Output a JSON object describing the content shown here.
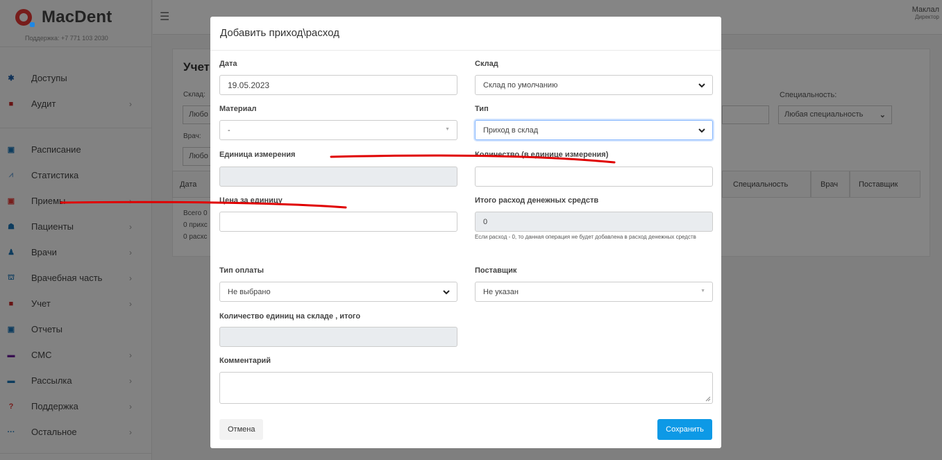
{
  "app": {
    "logo_text": "MacDent",
    "support": "Поддержка: +7 771 103 2030"
  },
  "user": {
    "name": "Маклал",
    "role": "Директор"
  },
  "sidebar": {
    "items": [
      {
        "label": "Доступы",
        "icon": "gear-icon",
        "color": "#1e5fa8",
        "glyph": "✱",
        "chevron": false
      },
      {
        "label": "Аудит",
        "icon": "briefcase-icon",
        "color": "#c62828",
        "glyph": "■",
        "chevron": true
      },
      {
        "label": "Расписание",
        "icon": "calendar-icon",
        "color": "#1a73b5",
        "glyph": "▣",
        "chevron": false
      },
      {
        "label": "Статистика",
        "icon": "chart-icon",
        "color": "#7aa7d6",
        "glyph": "⩘",
        "chevron": false
      },
      {
        "label": "Приемы",
        "icon": "calendar-check-icon",
        "color": "#e53935",
        "glyph": "▣",
        "chevron": true
      },
      {
        "label": "Пациенты",
        "icon": "users-icon",
        "color": "#1a73b5",
        "glyph": "☗",
        "chevron": true
      },
      {
        "label": "Врачи",
        "icon": "doctor-icon",
        "color": "#1a73b5",
        "glyph": "♟",
        "chevron": true
      },
      {
        "label": "Врачебная часть",
        "icon": "hospital-icon",
        "color": "#1a73b5",
        "glyph": "⛫",
        "chevron": true
      },
      {
        "label": "Учет",
        "icon": "briefcase-icon",
        "color": "#c62828",
        "glyph": "■",
        "chevron": true
      },
      {
        "label": "Отчеты",
        "icon": "calendar-icon",
        "color": "#1a73b5",
        "glyph": "▣",
        "chevron": false
      },
      {
        "label": "СМС",
        "icon": "sms-icon",
        "color": "#6a1b9a",
        "glyph": "▬",
        "chevron": true
      },
      {
        "label": "Рассылка",
        "icon": "message-icon",
        "color": "#1a73b5",
        "glyph": "▬",
        "chevron": true
      },
      {
        "label": "Поддержка",
        "icon": "question-icon",
        "color": "#e53935",
        "glyph": "?",
        "chevron": true
      },
      {
        "label": "Остальное",
        "icon": "dots-icon",
        "color": "#1a73b5",
        "glyph": "···",
        "chevron": true
      }
    ]
  },
  "background": {
    "title": "Учет",
    "sklad_label": "Склад:",
    "sklad_value": "Любо",
    "vrach_label": "Врач:",
    "vrach_value": "Любо",
    "spec_label": "Специальность:",
    "spec_value": "Любая специальность",
    "table_headers": [
      "Дата",
      "Специальность",
      "Врач",
      "Поставщик"
    ],
    "summary": [
      "Всего 0",
      "0 прихс",
      "0 расхс"
    ]
  },
  "modal": {
    "title": "Добавить приход\\расход",
    "date_label": "Дата",
    "date_value": "19.05.2023",
    "sklad_label": "Склад",
    "sklad_value": "Склад по умолчанию",
    "material_label": "Материал",
    "material_value": "-",
    "type_label": "Тип",
    "type_value": "Приход в склад",
    "unit_label": "Единица измерения",
    "unit_value": "",
    "qty_label": "Количество (в единице измерения)",
    "qty_value": "",
    "price_label": "Цена за единицу",
    "price_value": "",
    "total_label": "Итого расход денежных средств",
    "total_value": "0",
    "total_hint": "Если расход - 0, то данная операция не будет добавлена в расход денежных средств",
    "payment_label": "Тип оплаты",
    "payment_value": "Не выбрано",
    "supplier_label": "Поставщик",
    "supplier_value": "Не указан",
    "stock_label": "Количество единиц на складе , итого",
    "stock_value": "",
    "comment_label": "Комментарий",
    "comment_value": "",
    "cancel_label": "Отмена",
    "save_label": "Сохранить"
  },
  "colors": {
    "accent": "#0d99e6",
    "annotation": "#e00000"
  }
}
